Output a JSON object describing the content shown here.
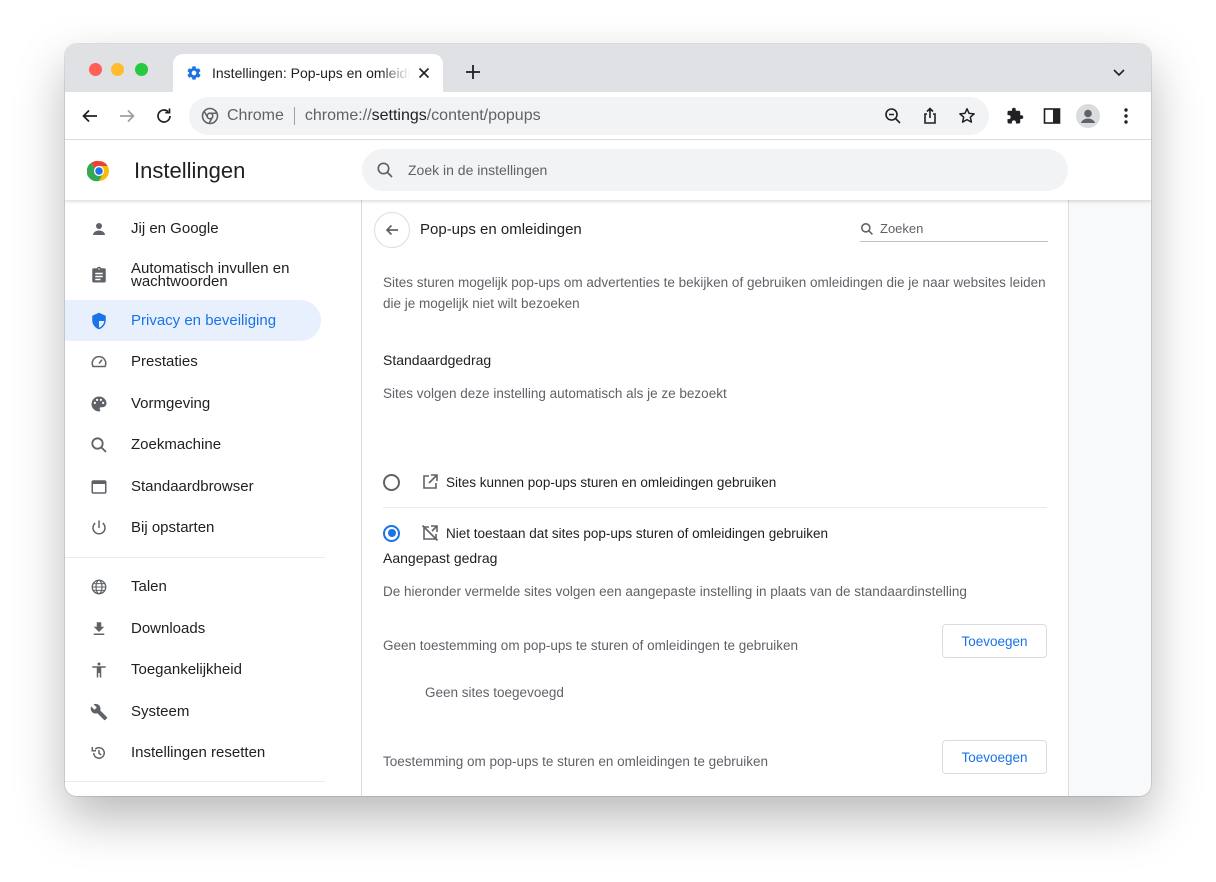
{
  "tab": {
    "title": "Instellingen: Pop-ups en omleidingen"
  },
  "omnibox": {
    "chip": "Chrome",
    "url_prefix": "chrome://",
    "url_host": "settings",
    "url_path": "/content/popups"
  },
  "header": {
    "title": "Instellingen",
    "search_placeholder": "Zoek in de instellingen"
  },
  "sidebar": {
    "items": [
      {
        "label": "Jij en Google",
        "icon": "person-icon"
      },
      {
        "label": "Automatisch invullen en wachtwoorden",
        "icon": "clipboard-icon"
      },
      {
        "label": "Privacy en beveiliging",
        "icon": "shield-icon",
        "active": true
      },
      {
        "label": "Prestaties",
        "icon": "speedometer-icon"
      },
      {
        "label": "Vormgeving",
        "icon": "palette-icon"
      },
      {
        "label": "Zoekmachine",
        "icon": "search-icon"
      },
      {
        "label": "Standaardbrowser",
        "icon": "browser-icon"
      },
      {
        "label": "Bij opstarten",
        "icon": "power-icon"
      },
      {
        "label": "Talen",
        "icon": "globe-icon"
      },
      {
        "label": "Downloads",
        "icon": "download-icon"
      },
      {
        "label": "Toegankelijkheid",
        "icon": "accessibility-icon"
      },
      {
        "label": "Systeem",
        "icon": "wrench-icon"
      },
      {
        "label": "Instellingen resetten",
        "icon": "history-icon"
      }
    ]
  },
  "main": {
    "title": "Pop-ups en omleidingen",
    "search_placeholder": "Zoeken",
    "description": "Sites sturen mogelijk pop-ups om advertenties te bekijken of gebruiken omleidingen die je naar websites leiden die je mogelijk niet wilt bezoeken",
    "default_heading": "Standaardgedrag",
    "default_desc": "Sites volgen deze instelling automatisch als je ze bezoekt",
    "options": [
      {
        "label": "Sites kunnen pop-ups sturen en omleidingen gebruiken",
        "checked": false
      },
      {
        "label": "Niet toestaan dat sites pop-ups sturen of omleidingen gebruiken",
        "checked": true
      }
    ],
    "custom_heading": "Aangepast gedrag",
    "custom_desc": "De hieronder vermelde sites volgen een aangepaste instelling in plaats van de standaardinstelling",
    "blocked_label": "Geen toestemming om pop-ups te sturen of omleidingen te gebruiken",
    "add_label": "Toevoegen",
    "empty_label": "Geen sites toegevoegd",
    "allowed_label": "Toestemming om pop-ups te sturen en omleidingen te gebruiken"
  },
  "colors": {
    "accent": "#1a73e8",
    "active_bg": "#e8f0fe",
    "tabstrip": "#dfe1e5"
  }
}
